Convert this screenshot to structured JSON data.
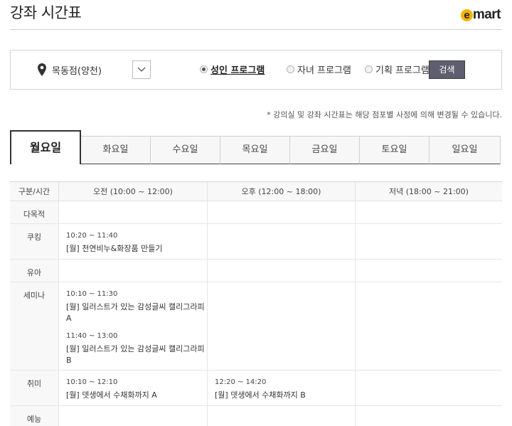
{
  "header": {
    "title": "강좌 시간표",
    "logo_letter": "e",
    "logo_text": "mart"
  },
  "filter": {
    "store": "목동점(양천)",
    "programs": [
      {
        "label": "성인 프로그램",
        "selected": true
      },
      {
        "label": "자녀 프로그램",
        "selected": false
      },
      {
        "label": "기획 프로그램",
        "selected": false
      }
    ],
    "search_label": "검색"
  },
  "notice": "* 강의실 및 강좌 시간표는 해당 점포별 사정에 의해 변경될 수 있습니다.",
  "tabs": [
    "월요일",
    "화요일",
    "수요일",
    "목요일",
    "금요일",
    "토요일",
    "일요일"
  ],
  "schedule": {
    "headers": [
      "구분/시간",
      "오전 (10:00 ~ 12:00)",
      "오후 (12:00 ~ 18:00)",
      "저녁 (18:00 ~ 21:00)"
    ],
    "rows": [
      {
        "category": "다목적",
        "morning": [],
        "afternoon": [],
        "evening": []
      },
      {
        "category": "쿠킹",
        "morning": [
          {
            "time": "10:20 ~ 11:40",
            "name": "[월] 천연비누&화장품 만들기"
          }
        ],
        "afternoon": [],
        "evening": []
      },
      {
        "category": "유아",
        "morning": [],
        "afternoon": [],
        "evening": []
      },
      {
        "category": "세미나",
        "morning": [
          {
            "time": "10:10 ~ 11:30",
            "name": "[월] 일러스트가 있는 감성글씨 캘리그라피 A"
          },
          {
            "time": "11:40 ~ 13:00",
            "name": "[월] 일러스트가 있는 감성글씨 캘리그라피 B"
          }
        ],
        "afternoon": [],
        "evening": []
      },
      {
        "category": "취미",
        "morning": [
          {
            "time": "10:10 ~ 12:10",
            "name": "[월] 뎃생에서 수채화까지 A"
          }
        ],
        "afternoon": [
          {
            "time": "12:20 ~ 14:20",
            "name": "[월] 뎃생에서 수채화까지 B"
          }
        ],
        "evening": []
      },
      {
        "category": "예능",
        "morning": [],
        "afternoon": [],
        "evening": []
      }
    ]
  }
}
